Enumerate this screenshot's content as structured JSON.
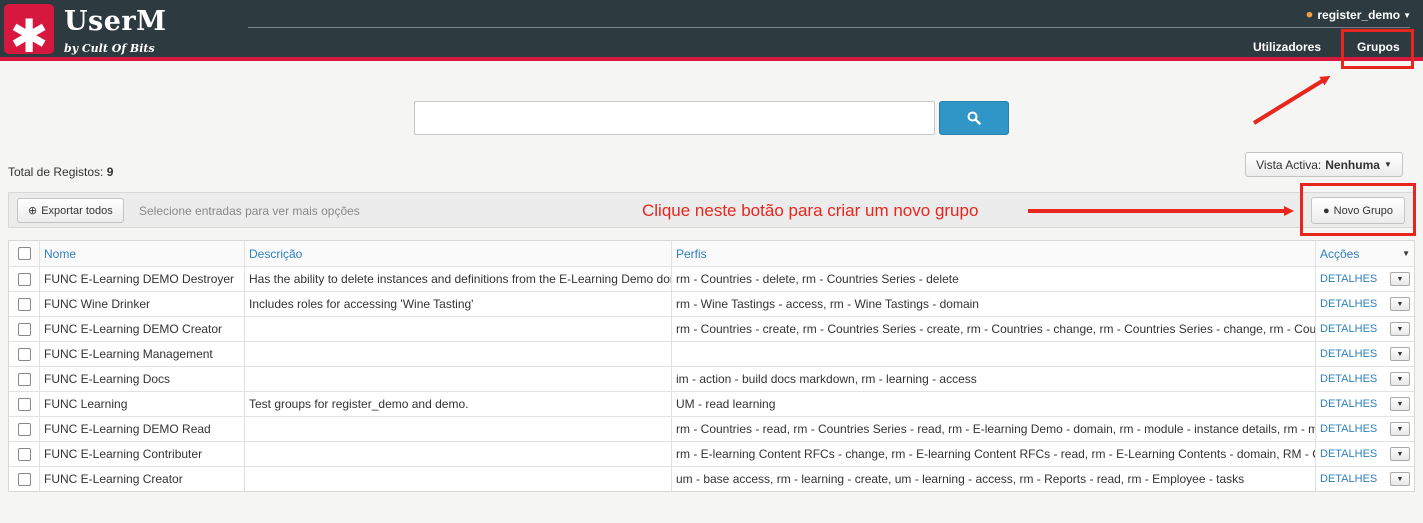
{
  "app": {
    "logo_symbol": "✱",
    "title": "UserM",
    "subtitle": "by Cult Of Bits"
  },
  "header": {
    "user": "register_demo",
    "nav": [
      {
        "label": "Utilizadores"
      },
      {
        "label": "Grupos"
      }
    ]
  },
  "search": {
    "placeholder": "",
    "icon": "search-icon"
  },
  "summary": {
    "total_label": "Total de Registos:",
    "total_value": "9"
  },
  "view": {
    "label": "Vista Activa:",
    "value": "Nenhuma"
  },
  "toolbar": {
    "export_label": "Exportar todos",
    "hint": "Selecione entradas para ver mais opções",
    "new_group_label": "Novo Grupo"
  },
  "annotation": {
    "text": "Clique neste botão para criar um novo grupo"
  },
  "colors": {
    "brand": "#d6183f",
    "header_bg": "#2d3a40",
    "link": "#2f7fbf",
    "annotation": "#e8261e",
    "search_button": "#2f96c7"
  },
  "table": {
    "columns": [
      "Nome",
      "Descrição",
      "Perfis",
      "Acções"
    ],
    "rows": [
      {
        "name": "FUNC E-Learning DEMO Destroyer",
        "desc": "Has the ability to delete instances and definitions from the E-Learning Demo domain",
        "profiles": "rm - Countries - delete, rm - Countries Series - delete",
        "action": "DETALHES"
      },
      {
        "name": "FUNC Wine Drinker",
        "desc": "Includes roles for accessing 'Wine Tasting'",
        "profiles": "rm - Wine Tastings - access, rm - Wine Tastings - domain",
        "action": "DETALHES"
      },
      {
        "name": "FUNC E-Learning DEMO Creator",
        "desc": "",
        "profiles": "rm - Countries - create, rm - Countries Series - create, rm - Countries - change, rm - Countries Series - change, rm - Countries - access",
        "action": "DETALHES"
      },
      {
        "name": "FUNC E-Learning Management",
        "desc": "",
        "profiles": "",
        "action": "DETALHES"
      },
      {
        "name": "FUNC E-Learning Docs",
        "desc": "",
        "profiles": "im - action - build docs markdown, rm - learning - access",
        "action": "DETALHES"
      },
      {
        "name": "FUNC Learning",
        "desc": "Test groups for register_demo and demo.",
        "profiles": "UM - read learning",
        "action": "DETALHES"
      },
      {
        "name": "FUNC E-Learning DEMO Read",
        "desc": "",
        "profiles": "rm - Countries - read, rm - Countries Series - read, rm - E-learning Demo - domain, rm - module - instance details, rm - module - read",
        "action": "DETALHES"
      },
      {
        "name": "FUNC E-Learning Contributer",
        "desc": "",
        "profiles": "rm - E-learning Content RFCs - change, rm - E-learning Content RFCs - read, rm - E-Learning Contents - domain, RM - Contents - read",
        "action": "DETALHES"
      },
      {
        "name": "FUNC E-Learning Creator",
        "desc": "",
        "profiles": "um - base access, rm - learning - create, um - learning - access, rm - Reports - read, rm - Employee - tasks",
        "action": "DETALHES"
      }
    ]
  }
}
